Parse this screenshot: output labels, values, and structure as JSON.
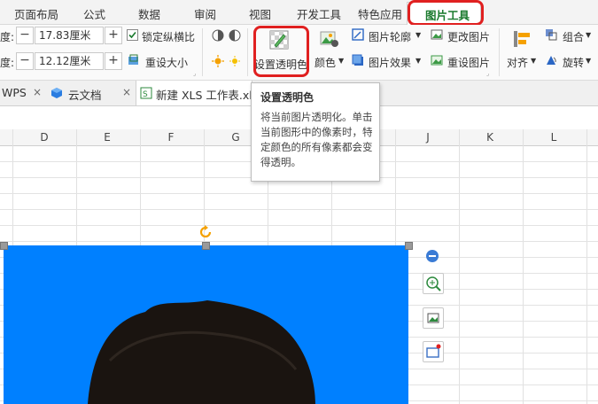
{
  "menu_tabs": [
    "页面布局",
    "公式",
    "数据",
    "审阅",
    "视图",
    "开发工具",
    "特色应用",
    "图片工具"
  ],
  "active_tab": "图片工具",
  "ribbon": {
    "height_label": "度:",
    "height_value": "17.83厘米",
    "width_label": "度:",
    "width_value": "12.12厘米",
    "lock_ratio": "锁定纵横比",
    "reset_size": "重设大小",
    "set_transparent": "设置透明色",
    "color": "颜色",
    "outline": "图片轮廓",
    "effect": "图片效果",
    "change_picture": "更改图片",
    "reset_picture": "重设图片",
    "align": "对齐",
    "group": "组合",
    "rotate": "旋转"
  },
  "doc_tabs": [
    "WPS",
    "云文档",
    "新建 XLS 工作表.xls"
  ],
  "columns": [
    "D",
    "E",
    "F",
    "G",
    "J",
    "K",
    "L"
  ],
  "tooltip": {
    "title": "设置透明色",
    "body": "将当前图片透明化。单击当前图形中的像素时，特定颜色的所有像素都会变得透明。"
  },
  "colors": {
    "accent_green": "#1b7a2e",
    "highlight_red": "#e02020",
    "picture_bg": "#0080ff"
  },
  "icons": [
    "minus-icon",
    "plus-icon",
    "checkbox-icon",
    "reset-size-icon",
    "transparent-color-icon",
    "color-icon",
    "outline-icon",
    "effect-icon",
    "change-picture-icon",
    "reset-picture-icon",
    "align-icon",
    "group-icon",
    "rotate-icon",
    "cloud-icon",
    "xls-file-icon",
    "close-icon",
    "rotate-handle-icon",
    "zoom-icon",
    "crop-icon",
    "collapse-icon"
  ]
}
